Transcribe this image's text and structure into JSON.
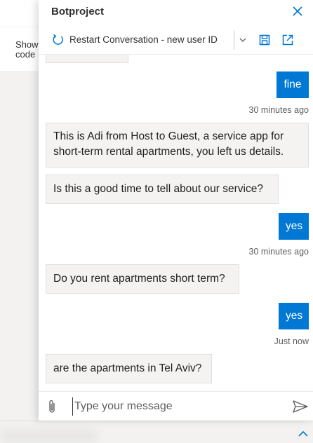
{
  "background": {
    "show_code_label": "Show code"
  },
  "panel": {
    "title": "Botproject",
    "toolbar": {
      "restart_label": "Restart Conversation - new user ID"
    },
    "transcript": {
      "partial_bot_fragment": "...",
      "messages": [
        {
          "from": "user",
          "text": "fine",
          "timestamp": "30 minutes ago"
        },
        {
          "from": "bot",
          "text": "This is Adi from Host to Guest, a service app for short-term rental apartments, you left us details."
        },
        {
          "from": "bot",
          "text": "Is this a good time to tell about our service?"
        },
        {
          "from": "user",
          "text": "yes",
          "timestamp": "30 minutes ago"
        },
        {
          "from": "bot",
          "text": "Do you rent apartments short term?"
        },
        {
          "from": "user",
          "text": "yes",
          "timestamp": "Just now"
        },
        {
          "from": "bot",
          "text": "are the apartments in Tel Aviv?"
        }
      ]
    },
    "input": {
      "placeholder": "Type your message",
      "value": ""
    }
  },
  "colors": {
    "accent": "#0078d4",
    "bot_bubble_bg": "#f4f3f2",
    "bot_bubble_border": "#e1dfdd"
  },
  "icons": {
    "close": "close-icon",
    "restart": "restart-icon",
    "dropdown": "chevron-down-icon",
    "save": "save-icon",
    "popout": "open-external-icon",
    "attach": "paperclip-icon",
    "send": "send-icon",
    "scroll_up": "chevron-up-icon"
  }
}
